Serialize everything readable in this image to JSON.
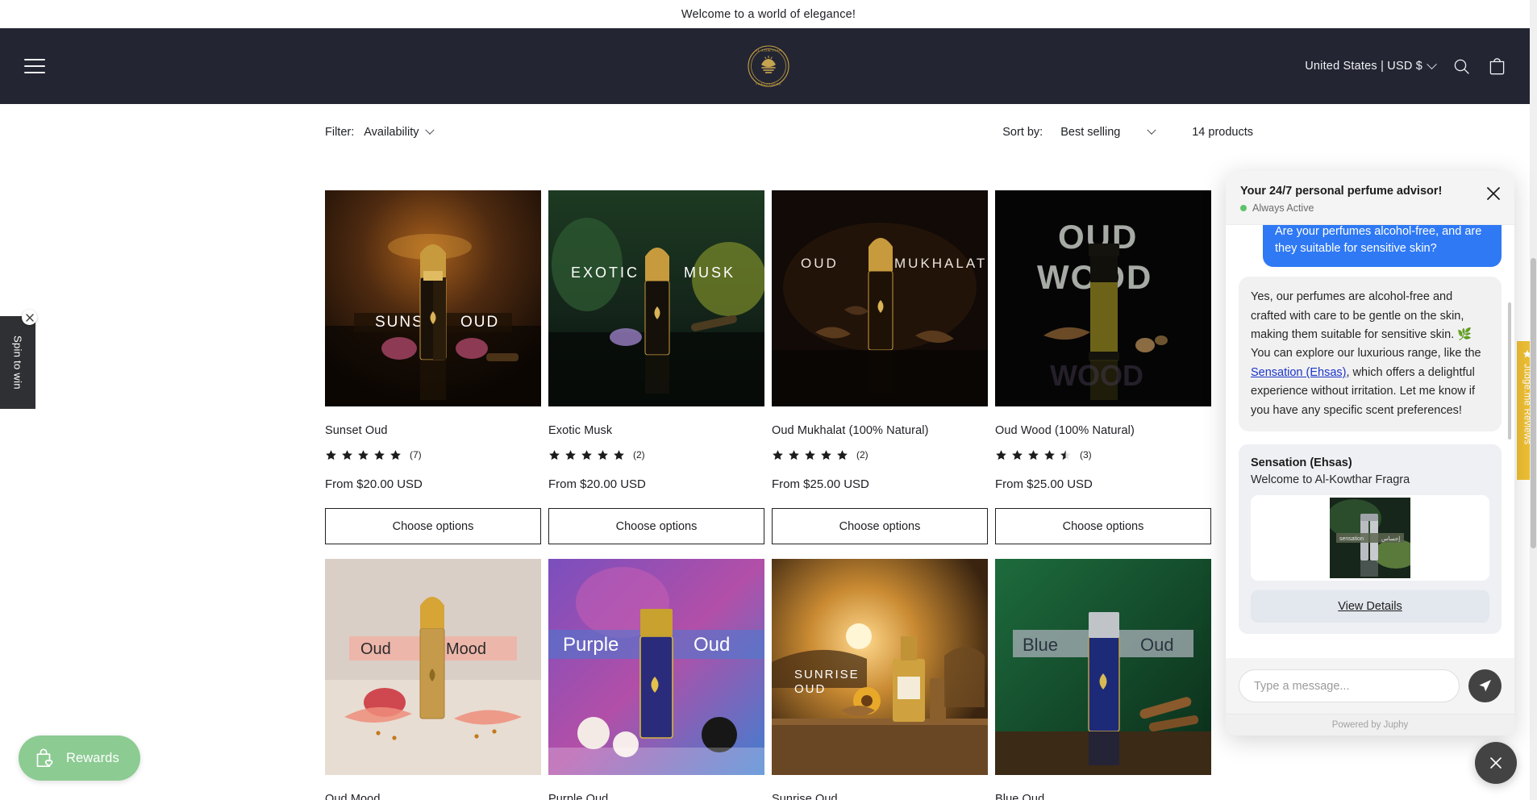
{
  "announcement": {
    "text": "Welcome to a world of elegance!"
  },
  "header": {
    "menu_icon": "hamburger-menu-icon",
    "logo_text": "AL-KOWTHAR FRAGRANCES",
    "country_label": "United States | USD $",
    "search_icon": "search-icon",
    "cart_icon": "shopping-bag-icon"
  },
  "toolbar": {
    "filter_label": "Filter:",
    "filter_value": "Availability",
    "sort_label": "Sort by:",
    "sort_value": "Best selling",
    "product_count": "14 products"
  },
  "products": [
    {
      "title": "Sunset Oud",
      "rating": 5,
      "reviews": "(7)",
      "price": "From $20.00 USD",
      "cta": "Choose options",
      "image_alt": "SUNSET OUD"
    },
    {
      "title": "Exotic Musk",
      "rating": 5,
      "reviews": "(2)",
      "price": "From $20.00 USD",
      "cta": "Choose options",
      "image_alt": "EXOTIC MUSK"
    },
    {
      "title": "Oud Mukhalat (100% Natural)",
      "rating": 5,
      "reviews": "(2)",
      "price": "From $25.00 USD",
      "cta": "Choose options",
      "image_alt": "OUD MUKHALAT"
    },
    {
      "title": "Oud Wood (100% Natural)",
      "rating": 4.5,
      "reviews": "(3)",
      "price": "From $25.00 USD",
      "cta": "Choose options",
      "image_alt": "OUD WOOD"
    },
    {
      "title": "Oud Mood",
      "image_alt": "Oud Mood"
    },
    {
      "title": "Purple Oud",
      "image_alt": "Purple Oud"
    },
    {
      "title": "Sunrise Oud",
      "image_alt": "SUNRISE OUD"
    },
    {
      "title": "Blue Oud",
      "image_alt": "Blue Oud"
    }
  ],
  "spin_widget": {
    "label": "Spin to win",
    "close_icon": "close-icon"
  },
  "rewards_widget": {
    "label": "Rewards",
    "icon": "shopping-bag-heart-icon",
    "color": "#8ccb92"
  },
  "judgeme_tab": {
    "label": "Judge.me Reviews",
    "icon": "star-icon",
    "color": "#efc033"
  },
  "chat": {
    "title": "Your 24/7 personal perfume advisor!",
    "status": "Always Active",
    "status_color": "#5ec269",
    "close_icon": "close-icon",
    "user_message": "Are your perfumes alcohol-free, and are they suitable for sensitive skin?",
    "bot_message_part1": "Yes, our perfumes are alcohol-free and crafted with care to be gentle on the skin, making them suitable for sensitive skin. 🌿 You can explore our luxurious range, like the ",
    "bot_link": "Sensation (Ehsas)",
    "bot_message_part2": ", which offers a delightful experience without irritation. Let me know if you have any specific scent preferences!",
    "product_card": {
      "name": "Sensation (Ehsas)",
      "subtitle": "Welcome to Al-Kowthar Fragra",
      "cta": "View Details",
      "image_alt": "Sensation Ehsas perfume bottle"
    },
    "input_placeholder": "Type a message...",
    "send_icon": "send-paper-plane-icon",
    "powered_by": "Powered by Juphy",
    "fab_icon": "close-icon",
    "accent_user_bubble": "#2f79f4"
  }
}
